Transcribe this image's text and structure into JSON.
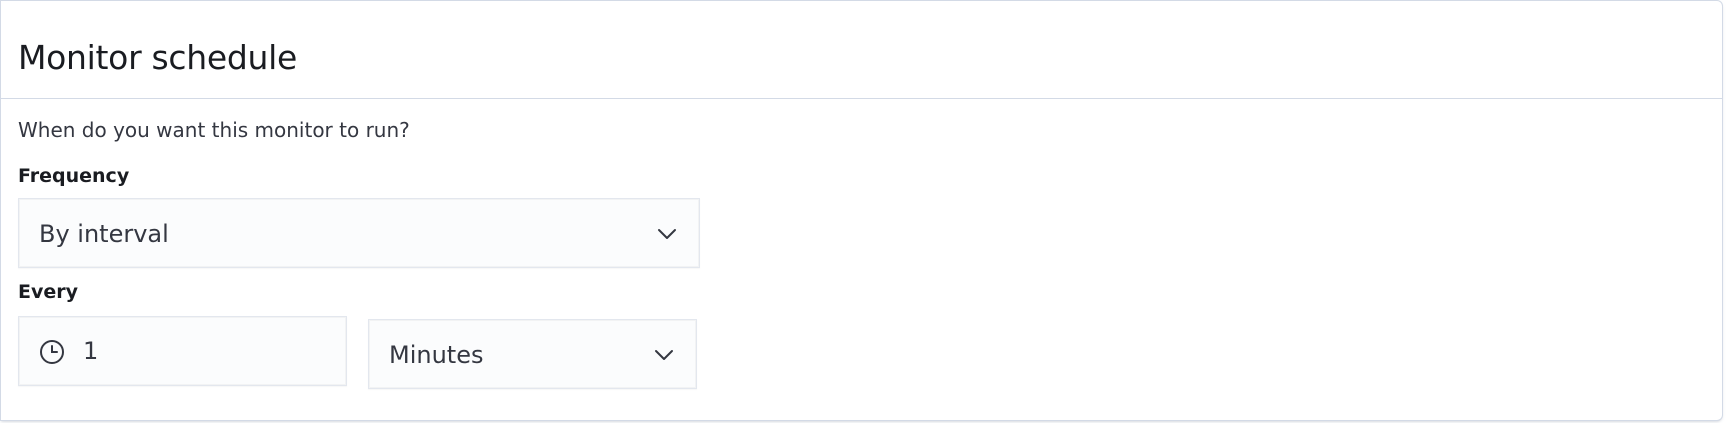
{
  "panel": {
    "title": "Monitor schedule",
    "description": "When do you want this monitor to run?"
  },
  "frequency": {
    "label": "Frequency",
    "selected": "By interval",
    "icon": "chevron-down-icon"
  },
  "every": {
    "label": "Every",
    "interval_value": "1",
    "interval_icon": "clock-icon",
    "unit_selected": "Minutes",
    "unit_icon": "chevron-down-icon"
  },
  "colors": {
    "text": "#1a1c21",
    "secondary_text": "#343741",
    "border": "#d3dae6",
    "field_bg": "#fbfcfd"
  }
}
